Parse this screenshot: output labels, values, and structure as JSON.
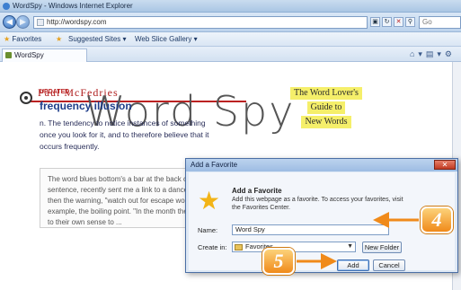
{
  "window": {
    "title": "WordSpy - Windows Internet Explorer"
  },
  "address_bar": {
    "url": "http://wordspy.com",
    "search_placeholder": "Go"
  },
  "favorites_bar": {
    "favorites_label": "Favorites",
    "suggested_sites": "Suggested Sites ▾",
    "web_slice": "Web Slice Gallery ▾"
  },
  "tab": {
    "label": "WordSpy"
  },
  "page": {
    "author": "Paul McFedries",
    "logo": "Word Spy",
    "tagline": [
      "The Word Lover's",
      "Guide to",
      "New Words"
    ],
    "updated_badge": "UPDATED",
    "headline": "frequency illusion",
    "definition": "n. The tendency to notice instances of something once you look for it, and to therefore believe that it occurs frequently.",
    "quote": "The word blues bottom's a bar at the back of a sentence, recently sent me a link to a dance. And then the warning, \"watch out for escape words\" for example, the boiling point. \"In the month they came to their own sense to ..."
  },
  "dialog": {
    "title": "Add a Favorite",
    "close_label": "✕",
    "heading": "Add a Favorite",
    "description": "Add this webpage as a favorite. To access your favorites, visit the Favorites Center.",
    "name_label": "Name:",
    "name_value": "Word Spy",
    "create_in_label": "Create in:",
    "create_in_value": "Favorites",
    "new_folder_label": "New Folder",
    "add_label": "Add",
    "cancel_label": "Cancel"
  },
  "callouts": {
    "step4": "4",
    "step5": "5"
  },
  "colors": {
    "callout": "#f2a33a",
    "logo_highlight": "#f5ef6a",
    "headline": "#1f3e8a"
  }
}
